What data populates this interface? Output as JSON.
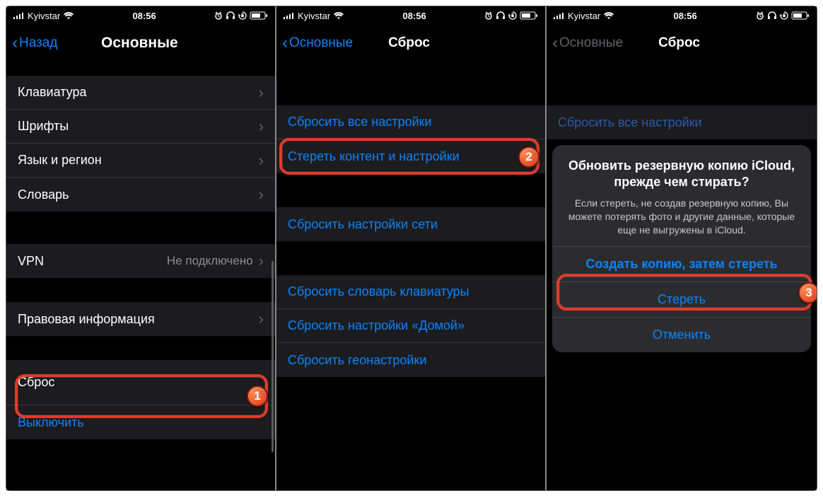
{
  "status": {
    "carrier": "Kyivstar",
    "time": "08:56"
  },
  "panel1": {
    "back": "Назад",
    "title": "Основные",
    "rows_a": [
      {
        "label": "Клавиатура"
      },
      {
        "label": "Шрифты"
      },
      {
        "label": "Язык и регион"
      },
      {
        "label": "Словарь"
      }
    ],
    "vpn": {
      "label": "VPN",
      "value": "Не подключено"
    },
    "legal": {
      "label": "Правовая информация"
    },
    "reset": {
      "label": "Сброс"
    },
    "shutdown": {
      "label": "Выключить"
    }
  },
  "panel2": {
    "back": "Основные",
    "title": "Сброс",
    "rows_a": [
      {
        "label": "Сбросить все настройки"
      },
      {
        "label": "Стереть контент и настройки"
      }
    ],
    "rows_b": [
      {
        "label": "Сбросить настройки сети"
      }
    ],
    "rows_c": [
      {
        "label": "Сбросить словарь клавиатуры"
      },
      {
        "label": "Сбросить настройки «Домой»"
      },
      {
        "label": "Сбросить геонастройки"
      }
    ]
  },
  "panel3": {
    "back": "Основные",
    "title": "Сброс",
    "rows_a": [
      {
        "label": "Сбросить все настройки"
      }
    ],
    "sheet": {
      "title": "Обновить резервную копию iCloud, прежде чем стирать?",
      "message": "Если стереть, не создав резервную копию, Вы можете потерять фото и другие данные, которые еще не выгружены в iCloud.",
      "primary": "Создать копию, затем стереть",
      "secondary": "Стереть",
      "cancel": "Отменить"
    }
  },
  "badges": {
    "b1": "1",
    "b2": "2",
    "b3": "3"
  }
}
